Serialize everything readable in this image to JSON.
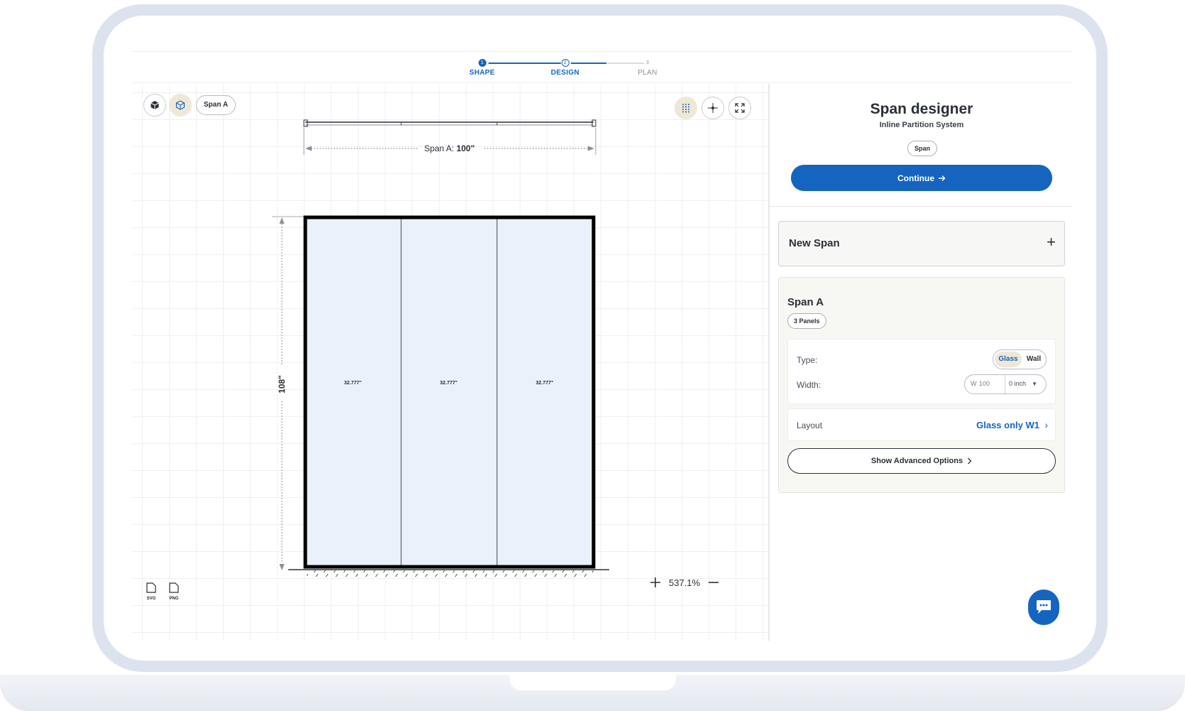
{
  "stepper": {
    "steps": [
      {
        "number": "1",
        "label": "SHAPE"
      },
      {
        "number": "2",
        "label": "DESIGN"
      },
      {
        "number": "3",
        "label": "PLAN"
      }
    ]
  },
  "toolbar": {
    "view_3d_icon": "cube-icon",
    "view_active_icon": "cube-outline-icon",
    "span_chip_label": "Span A",
    "grid_icon": "grid-dots-icon",
    "center_icon": "crosshair-icon",
    "fullscreen_icon": "expand-icon"
  },
  "drawing": {
    "span_dimension_prefix": "Span A: ",
    "span_dimension_value": "100\"",
    "height_dimension": "108\"",
    "panels": [
      {
        "width_label": "32.777\""
      },
      {
        "width_label": "32.777\""
      },
      {
        "width_label": "32.777\""
      }
    ]
  },
  "export": {
    "svg_label": "SVG",
    "png_label": "PNG"
  },
  "zoom": {
    "level": "537.1%"
  },
  "sidebar": {
    "title": "Span designer",
    "subtitle": "Inline Partition System",
    "tag": "Span",
    "continue_label": "Continue",
    "new_span_label": "New Span",
    "span": {
      "name": "Span A",
      "panels_badge": "3 Panels",
      "type_label": "Type:",
      "type_options": [
        "Glass",
        "Wall"
      ],
      "type_selected": "Glass",
      "width_label": "Width:",
      "width_prefix": "W",
      "width_value": "100",
      "width_unit": "0 inch",
      "layout_label": "Layout",
      "layout_value": "Glass only W1",
      "advanced_label": "Show Advanced Options"
    }
  },
  "colors": {
    "accent": "#1565c0",
    "active_chip": "#efe8d6",
    "glass_fill": "#e9f1fa"
  }
}
